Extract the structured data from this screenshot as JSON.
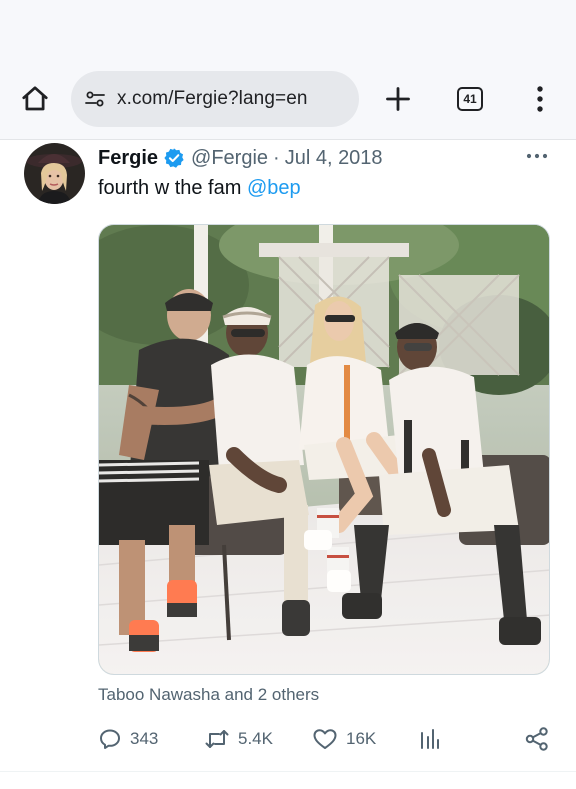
{
  "browser": {
    "url": "x.com/Fergie?lang=en",
    "tab_count": "41"
  },
  "tweet": {
    "display_name": "Fergie",
    "handle": "@Fergie",
    "separator": "·",
    "date": "Jul 4, 2018",
    "text": "fourth w the fam ",
    "mention": "@bep",
    "tagged": "Taboo Nawasha and 2 others",
    "replies": "343",
    "reposts": "5.4K",
    "likes": "16K"
  },
  "colors": {
    "accent": "#1d9bf0",
    "secondary_text": "#536471",
    "primary_text": "#0f1419"
  }
}
